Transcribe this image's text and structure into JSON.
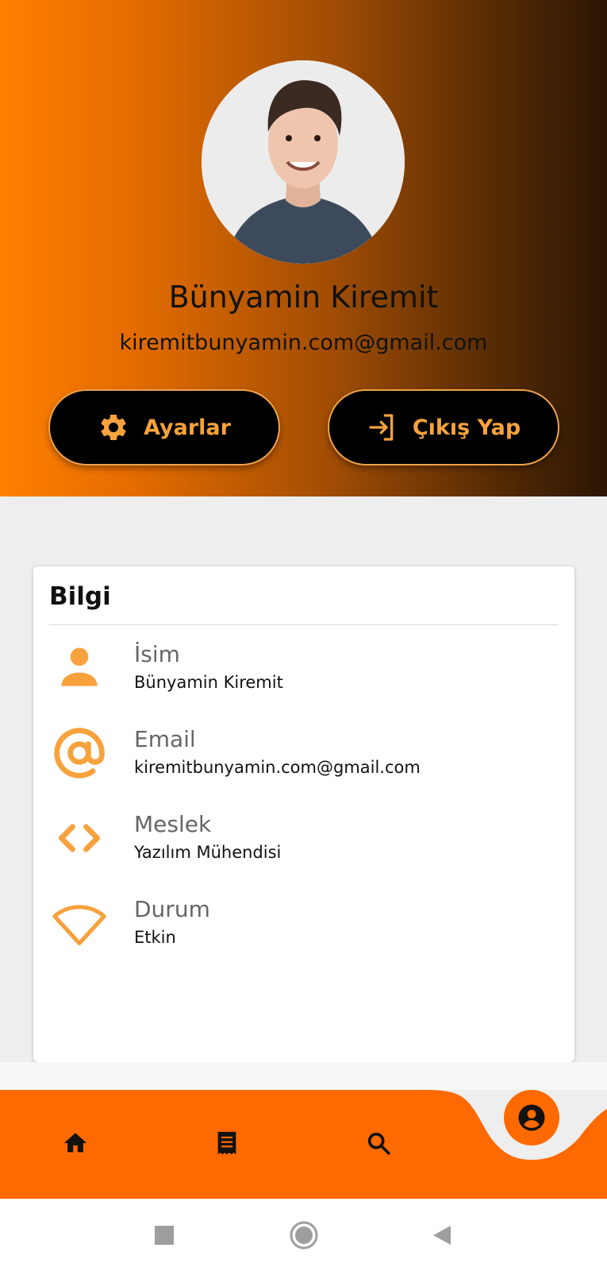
{
  "colors": {
    "accent": "#f7a23c",
    "nav_orange": "#ff6a00",
    "header_gradient_start": "#ff8000",
    "header_gradient_end": "#2a1603"
  },
  "profile": {
    "name": "Bünyamin Kiremit",
    "email": "kiremitbunyamin.com@gmail.com"
  },
  "actions": {
    "settings_label": "Ayarlar",
    "settings_icon": "gear-icon",
    "logout_label": "Çıkış Yap",
    "logout_icon": "login-arrow-icon"
  },
  "info_card": {
    "title": "Bilgi",
    "rows": [
      {
        "icon": "person-icon",
        "label": "İsim",
        "value": "Bünyamin Kiremit"
      },
      {
        "icon": "at-sign-icon",
        "label": "Email",
        "value": "kiremitbunyamin.com@gmail.com"
      },
      {
        "icon": "code-icon",
        "label": "Meslek",
        "value": "Yazılım Mühendisi"
      },
      {
        "icon": "wifi-icon",
        "label": "Durum",
        "value": "Etkin"
      }
    ]
  },
  "bottom_nav": {
    "items": [
      {
        "icon": "home-icon"
      },
      {
        "icon": "receipt-list-icon"
      },
      {
        "icon": "search-icon"
      },
      {
        "icon": "account-circle-icon",
        "active": true
      }
    ]
  },
  "system_nav": {
    "items": [
      {
        "icon": "recents-square-icon"
      },
      {
        "icon": "home-circle-icon"
      },
      {
        "icon": "back-triangle-icon"
      }
    ]
  }
}
